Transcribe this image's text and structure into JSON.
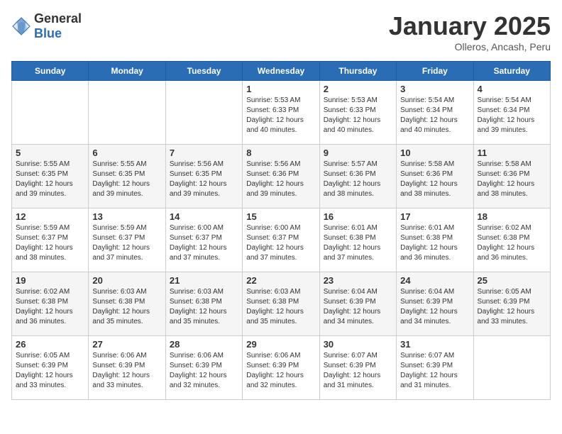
{
  "logo": {
    "text_general": "General",
    "text_blue": "Blue"
  },
  "header": {
    "title": "January 2025",
    "subtitle": "Olleros, Ancash, Peru"
  },
  "days_of_week": [
    "Sunday",
    "Monday",
    "Tuesday",
    "Wednesday",
    "Thursday",
    "Friday",
    "Saturday"
  ],
  "weeks": [
    [
      {
        "day": "",
        "sunrise": "",
        "sunset": "",
        "daylight": ""
      },
      {
        "day": "",
        "sunrise": "",
        "sunset": "",
        "daylight": ""
      },
      {
        "day": "",
        "sunrise": "",
        "sunset": "",
        "daylight": ""
      },
      {
        "day": "1",
        "sunrise": "Sunrise: 5:53 AM",
        "sunset": "Sunset: 6:33 PM",
        "daylight": "Daylight: 12 hours and 40 minutes."
      },
      {
        "day": "2",
        "sunrise": "Sunrise: 5:53 AM",
        "sunset": "Sunset: 6:33 PM",
        "daylight": "Daylight: 12 hours and 40 minutes."
      },
      {
        "day": "3",
        "sunrise": "Sunrise: 5:54 AM",
        "sunset": "Sunset: 6:34 PM",
        "daylight": "Daylight: 12 hours and 40 minutes."
      },
      {
        "day": "4",
        "sunrise": "Sunrise: 5:54 AM",
        "sunset": "Sunset: 6:34 PM",
        "daylight": "Daylight: 12 hours and 39 minutes."
      }
    ],
    [
      {
        "day": "5",
        "sunrise": "Sunrise: 5:55 AM",
        "sunset": "Sunset: 6:35 PM",
        "daylight": "Daylight: 12 hours and 39 minutes."
      },
      {
        "day": "6",
        "sunrise": "Sunrise: 5:55 AM",
        "sunset": "Sunset: 6:35 PM",
        "daylight": "Daylight: 12 hours and 39 minutes."
      },
      {
        "day": "7",
        "sunrise": "Sunrise: 5:56 AM",
        "sunset": "Sunset: 6:35 PM",
        "daylight": "Daylight: 12 hours and 39 minutes."
      },
      {
        "day": "8",
        "sunrise": "Sunrise: 5:56 AM",
        "sunset": "Sunset: 6:36 PM",
        "daylight": "Daylight: 12 hours and 39 minutes."
      },
      {
        "day": "9",
        "sunrise": "Sunrise: 5:57 AM",
        "sunset": "Sunset: 6:36 PM",
        "daylight": "Daylight: 12 hours and 38 minutes."
      },
      {
        "day": "10",
        "sunrise": "Sunrise: 5:58 AM",
        "sunset": "Sunset: 6:36 PM",
        "daylight": "Daylight: 12 hours and 38 minutes."
      },
      {
        "day": "11",
        "sunrise": "Sunrise: 5:58 AM",
        "sunset": "Sunset: 6:36 PM",
        "daylight": "Daylight: 12 hours and 38 minutes."
      }
    ],
    [
      {
        "day": "12",
        "sunrise": "Sunrise: 5:59 AM",
        "sunset": "Sunset: 6:37 PM",
        "daylight": "Daylight: 12 hours and 38 minutes."
      },
      {
        "day": "13",
        "sunrise": "Sunrise: 5:59 AM",
        "sunset": "Sunset: 6:37 PM",
        "daylight": "Daylight: 12 hours and 37 minutes."
      },
      {
        "day": "14",
        "sunrise": "Sunrise: 6:00 AM",
        "sunset": "Sunset: 6:37 PM",
        "daylight": "Daylight: 12 hours and 37 minutes."
      },
      {
        "day": "15",
        "sunrise": "Sunrise: 6:00 AM",
        "sunset": "Sunset: 6:37 PM",
        "daylight": "Daylight: 12 hours and 37 minutes."
      },
      {
        "day": "16",
        "sunrise": "Sunrise: 6:01 AM",
        "sunset": "Sunset: 6:38 PM",
        "daylight": "Daylight: 12 hours and 37 minutes."
      },
      {
        "day": "17",
        "sunrise": "Sunrise: 6:01 AM",
        "sunset": "Sunset: 6:38 PM",
        "daylight": "Daylight: 12 hours and 36 minutes."
      },
      {
        "day": "18",
        "sunrise": "Sunrise: 6:02 AM",
        "sunset": "Sunset: 6:38 PM",
        "daylight": "Daylight: 12 hours and 36 minutes."
      }
    ],
    [
      {
        "day": "19",
        "sunrise": "Sunrise: 6:02 AM",
        "sunset": "Sunset: 6:38 PM",
        "daylight": "Daylight: 12 hours and 36 minutes."
      },
      {
        "day": "20",
        "sunrise": "Sunrise: 6:03 AM",
        "sunset": "Sunset: 6:38 PM",
        "daylight": "Daylight: 12 hours and 35 minutes."
      },
      {
        "day": "21",
        "sunrise": "Sunrise: 6:03 AM",
        "sunset": "Sunset: 6:38 PM",
        "daylight": "Daylight: 12 hours and 35 minutes."
      },
      {
        "day": "22",
        "sunrise": "Sunrise: 6:03 AM",
        "sunset": "Sunset: 6:38 PM",
        "daylight": "Daylight: 12 hours and 35 minutes."
      },
      {
        "day": "23",
        "sunrise": "Sunrise: 6:04 AM",
        "sunset": "Sunset: 6:39 PM",
        "daylight": "Daylight: 12 hours and 34 minutes."
      },
      {
        "day": "24",
        "sunrise": "Sunrise: 6:04 AM",
        "sunset": "Sunset: 6:39 PM",
        "daylight": "Daylight: 12 hours and 34 minutes."
      },
      {
        "day": "25",
        "sunrise": "Sunrise: 6:05 AM",
        "sunset": "Sunset: 6:39 PM",
        "daylight": "Daylight: 12 hours and 33 minutes."
      }
    ],
    [
      {
        "day": "26",
        "sunrise": "Sunrise: 6:05 AM",
        "sunset": "Sunset: 6:39 PM",
        "daylight": "Daylight: 12 hours and 33 minutes."
      },
      {
        "day": "27",
        "sunrise": "Sunrise: 6:06 AM",
        "sunset": "Sunset: 6:39 PM",
        "daylight": "Daylight: 12 hours and 33 minutes."
      },
      {
        "day": "28",
        "sunrise": "Sunrise: 6:06 AM",
        "sunset": "Sunset: 6:39 PM",
        "daylight": "Daylight: 12 hours and 32 minutes."
      },
      {
        "day": "29",
        "sunrise": "Sunrise: 6:06 AM",
        "sunset": "Sunset: 6:39 PM",
        "daylight": "Daylight: 12 hours and 32 minutes."
      },
      {
        "day": "30",
        "sunrise": "Sunrise: 6:07 AM",
        "sunset": "Sunset: 6:39 PM",
        "daylight": "Daylight: 12 hours and 31 minutes."
      },
      {
        "day": "31",
        "sunrise": "Sunrise: 6:07 AM",
        "sunset": "Sunset: 6:39 PM",
        "daylight": "Daylight: 12 hours and 31 minutes."
      },
      {
        "day": "",
        "sunrise": "",
        "sunset": "",
        "daylight": ""
      }
    ]
  ]
}
